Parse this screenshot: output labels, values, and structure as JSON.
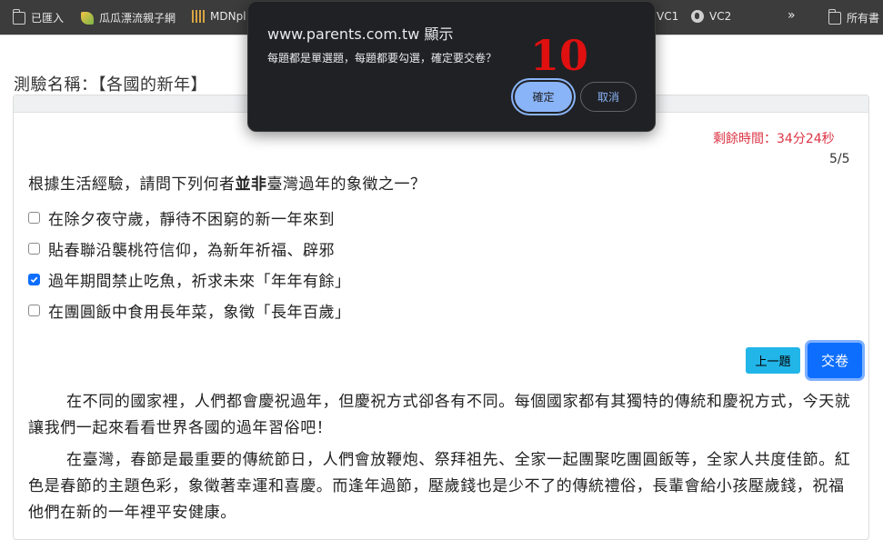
{
  "bookmarks": {
    "imported": "已匯入",
    "guagua": "瓜瓜漂流親子網",
    "mdn": "MDNpl",
    "vc1": "VC1",
    "vc2": "VC2",
    "more": "»",
    "all": "所有書"
  },
  "quiz": {
    "title": "測驗名稱：【各國的新年】",
    "timer": "剩餘時間：34分24秒",
    "progress": "5/5",
    "question_before": "根據生活經驗，請問下列何者",
    "question_bold": "並非",
    "question_after": "臺灣過年的象徵之一？",
    "options": [
      {
        "label": "在除夕夜守歲，靜待不困窮的新一年來到",
        "checked": false
      },
      {
        "label": "貼春聯沿襲桃符信仰，為新年祈福、辟邪",
        "checked": false
      },
      {
        "label": "過年期間禁止吃魚，祈求未來「年年有餘」",
        "checked": true
      },
      {
        "label": "在團圓飯中食用長年菜，象徵「長年百歲」",
        "checked": false
      }
    ],
    "prev_button": "上一題",
    "submit_button": "交卷",
    "paragraph1": "在不同的國家裡，人們都會慶祝過年，但慶祝方式卻各有不同。每個國家都有其獨特的傳統和慶祝方式，今天就讓我們一起來看看世界各國的過年習俗吧！",
    "paragraph2": "在臺灣，春節是最重要的傳統節日，人們會放鞭炮、祭拜祖先、全家一起團聚吃團圓飯等，全家人共度佳節。紅色是春節的主題色彩，象徵著幸運和喜慶。而逢年過節，壓歲錢也是少不了的傳統禮俗，長輩會給小孩壓歲錢，祝福他們在新的一年裡平安健康。"
  },
  "dialog": {
    "title": "www.parents.com.tw 顯示",
    "message": "每題都是單選題，每題都要勾選，確定要交卷？",
    "annotation": "10",
    "ok": "確定",
    "cancel": "取消"
  },
  "colors": {
    "timer": "#dc3545",
    "submit": "#0d6efd",
    "prev": "#22b5e8",
    "dialog_bg": "#202124",
    "dialog_accent": "#8ab4f8",
    "annotation": "#e01010"
  }
}
